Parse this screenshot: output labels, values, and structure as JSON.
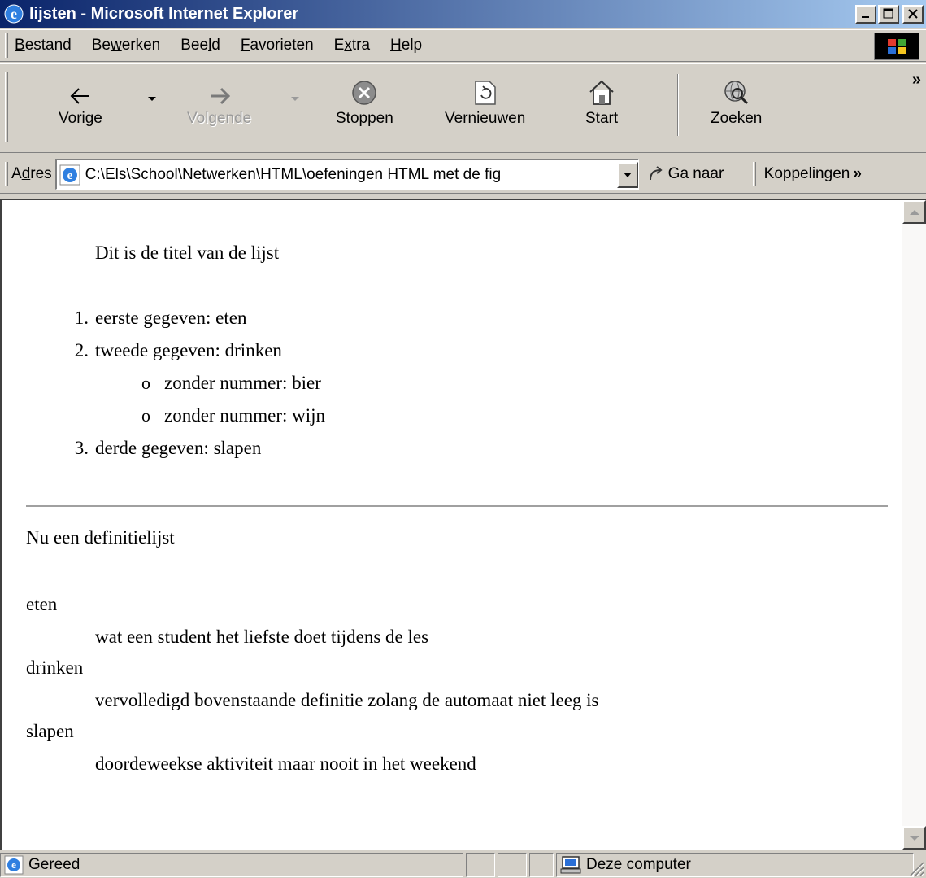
{
  "window": {
    "title": "lijsten - Microsoft Internet Explorer",
    "minimize_label": "_",
    "maximize_label": "□",
    "close_label": "×"
  },
  "menu": {
    "items": [
      {
        "pre": "",
        "key": "B",
        "post": "estand"
      },
      {
        "pre": "Be",
        "key": "w",
        "post": "erken"
      },
      {
        "pre": "Bee",
        "key": "l",
        "post": "d"
      },
      {
        "pre": "",
        "key": "F",
        "post": "avorieten"
      },
      {
        "pre": "E",
        "key": "x",
        "post": "tra"
      },
      {
        "pre": "",
        "key": "H",
        "post": "elp"
      }
    ]
  },
  "toolbar": {
    "back": "Vorige",
    "forward": "Volgende",
    "stop": "Stoppen",
    "refresh": "Vernieuwen",
    "home": "Start",
    "search": "Zoeken",
    "more": "»"
  },
  "address": {
    "label_pre": "A",
    "label_key": "d",
    "label_post": "res",
    "value": "C:\\Els\\School\\Netwerken\\HTML\\oefeningen HTML met de fig",
    "go": "Ga naar",
    "links": "Koppelingen",
    "links_more": "»"
  },
  "page": {
    "list_title": "Dit is de titel van de lijst",
    "ordered": [
      {
        "num": "1.",
        "text": "eerste gegeven: eten"
      },
      {
        "num": "2.",
        "text": "tweede gegeven: drinken"
      },
      {
        "num": "3.",
        "text": "derde gegeven: slapen"
      }
    ],
    "unordered": [
      {
        "bullet": "o",
        "text": "zonder nummer: bier"
      },
      {
        "bullet": "o",
        "text": "zonder nummer: wijn"
      }
    ],
    "dl_heading": "Nu een definitielijst",
    "definitions": [
      {
        "term": "eten",
        "desc": "wat een student het liefste doet tijdens de les"
      },
      {
        "term": "drinken",
        "desc": "vervolledigd bovenstaande definitie zolang de automaat niet leeg is"
      },
      {
        "term": "slapen",
        "desc": "doordeweekse aktiviteit maar nooit in het weekend"
      }
    ]
  },
  "status": {
    "text": "Gereed",
    "zone": "Deze computer"
  },
  "colors": {
    "titlebar_start": "#0a246a",
    "titlebar_end": "#a6caf0",
    "chrome": "#d4d0c8"
  }
}
